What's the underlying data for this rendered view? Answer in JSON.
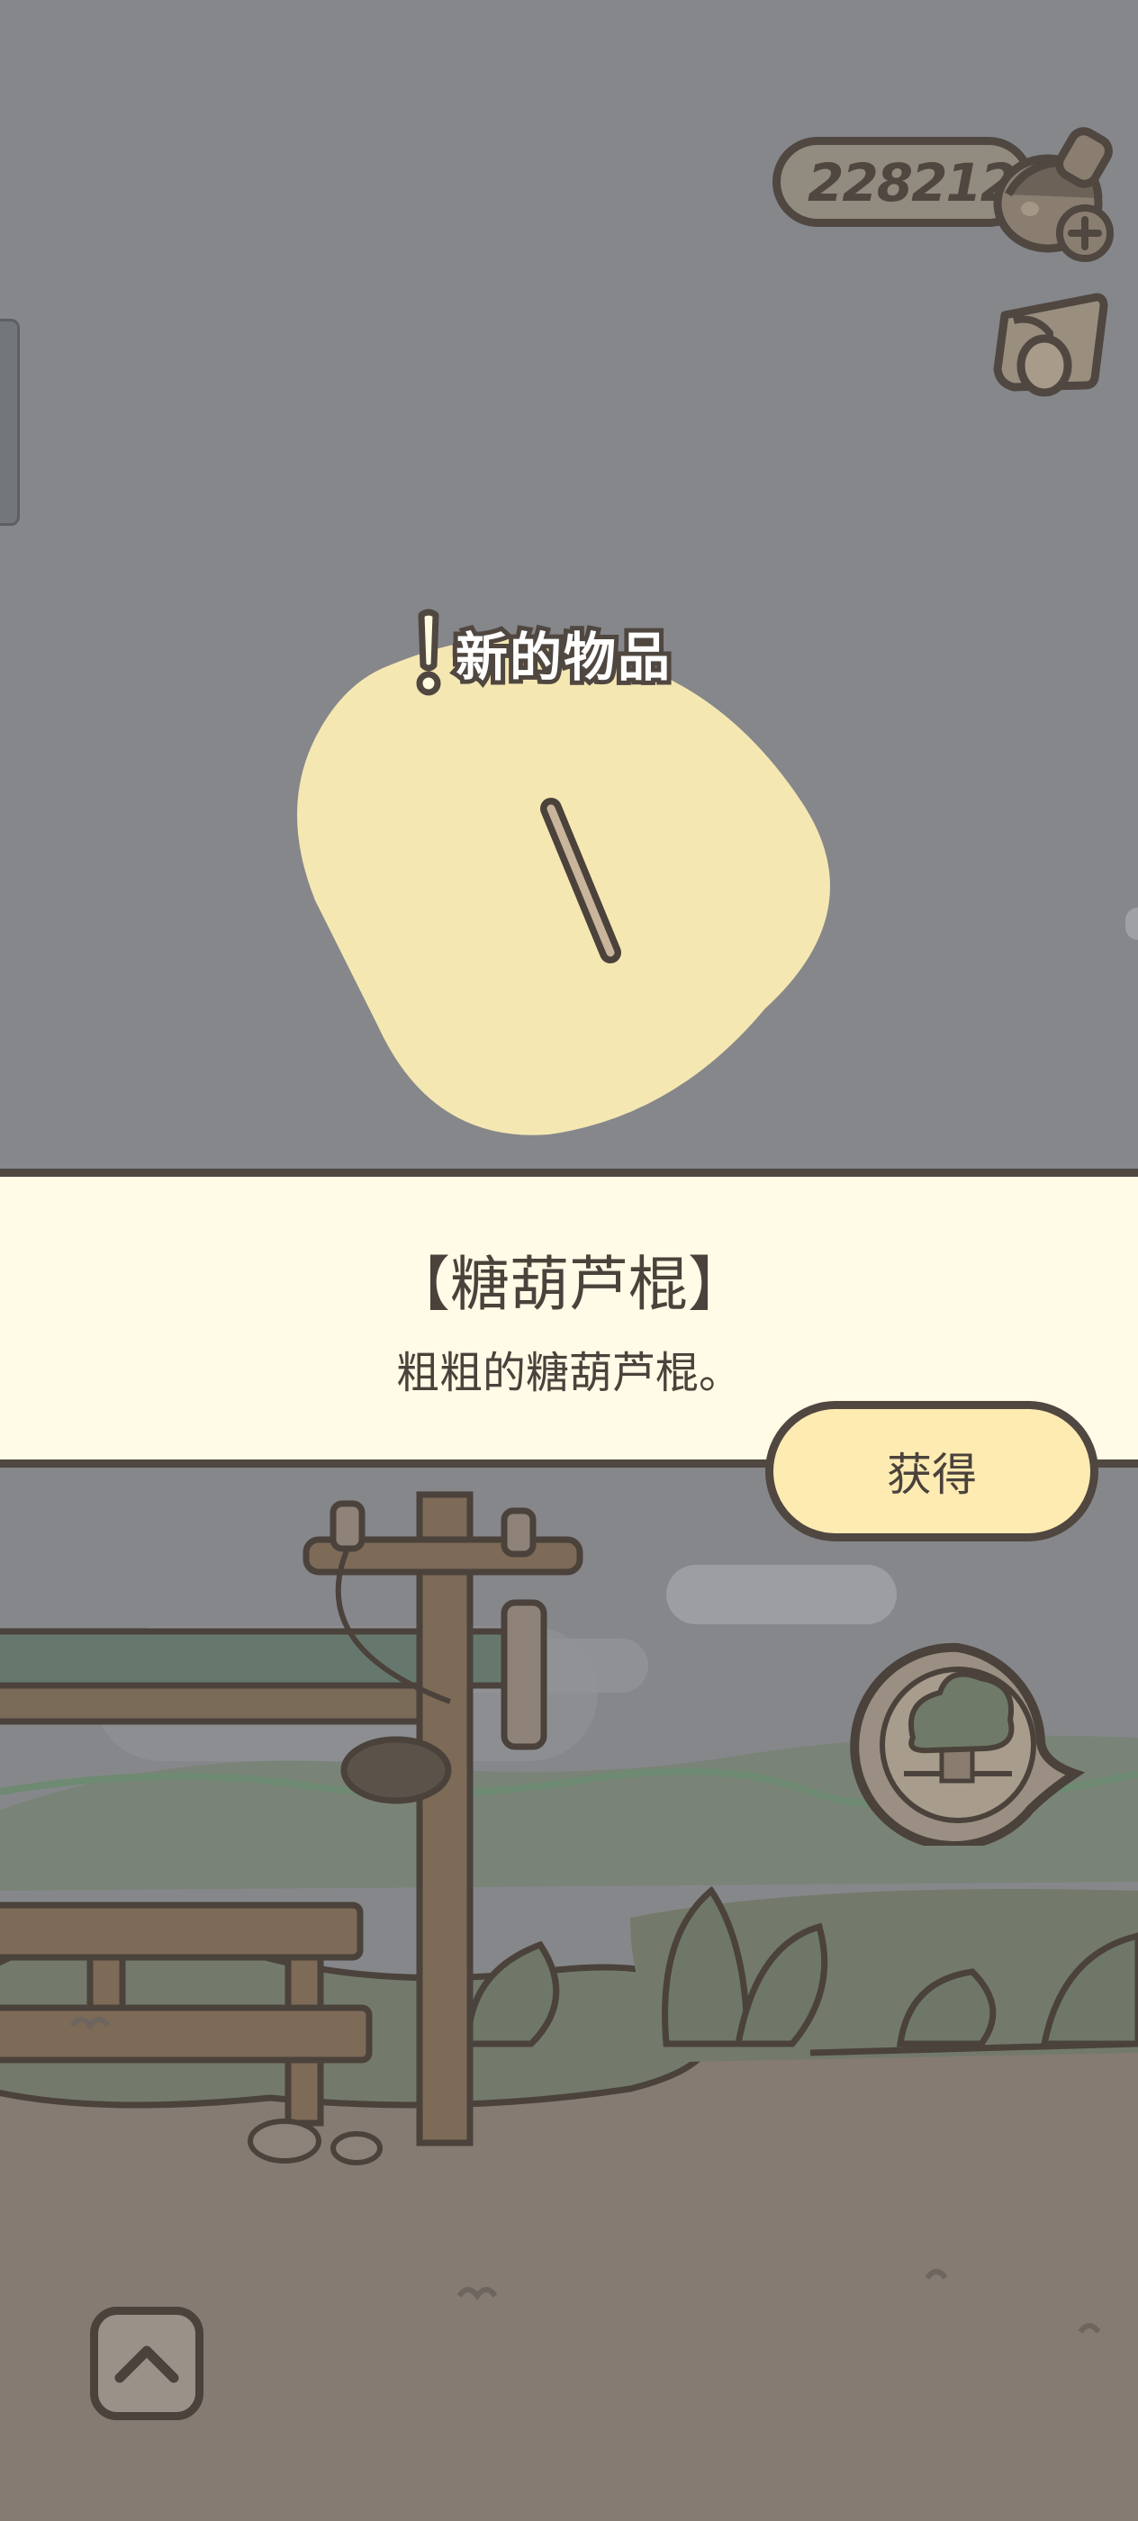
{
  "hud": {
    "currency_value": "228212",
    "currency_icon": "acorn-icon",
    "add_icon": "plus-icon",
    "mail_icon": "letter-icon"
  },
  "popup": {
    "tag_label": "新的物品",
    "tag_icon": "exclaim-icon",
    "item_icon": "stick-icon",
    "item_name": "【糖葫芦棍】",
    "item_description": "粗粗的糖葫芦棍。",
    "obtain_button_label": "获得"
  },
  "scene": {
    "map_bubble_icon": "tree-icon",
    "scroll_button_icon": "chevron-up-icon"
  },
  "colors": {
    "dim_overlay": "#85878b",
    "banner_bg": "#fffbe6",
    "outline": "#4f4740",
    "blob": "#f5e7b2",
    "button_bg": "#fdebb2"
  }
}
